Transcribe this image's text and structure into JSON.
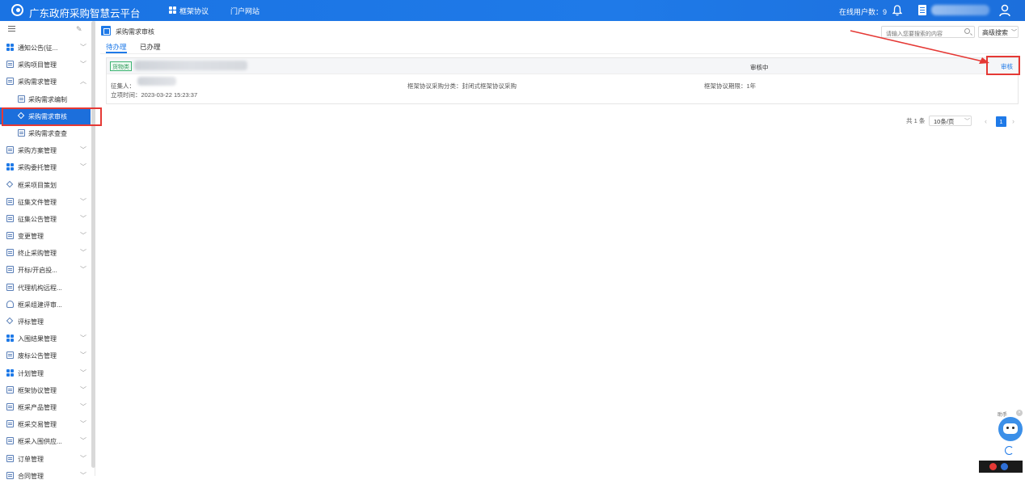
{
  "header": {
    "app_title": "广东政府采购智慧云平台",
    "nav": [
      "框架协议",
      "门户网站"
    ],
    "online_users": "在线用户数：9"
  },
  "sidebar": {
    "items": [
      {
        "label": "通知公告(征...",
        "icon": "grid-icon",
        "expandable": true
      },
      {
        "label": "采购项目管理",
        "icon": "doc-icon",
        "expandable": true
      },
      {
        "label": "采购需求管理",
        "icon": "doc-icon",
        "expandable": true,
        "expanded": true
      },
      {
        "label": "采购需求编制",
        "icon": "edit-icon",
        "sub": true
      },
      {
        "label": "采购需求审核",
        "icon": "diamond-icon",
        "sub": true,
        "active": true
      },
      {
        "label": "采购需求查查",
        "icon": "doc-icon",
        "sub": true
      },
      {
        "label": "采购方案管理",
        "icon": "doc-icon",
        "expandable": true
      },
      {
        "label": "采购委托管理",
        "icon": "grid-icon",
        "expandable": true
      },
      {
        "label": "框采项目策划",
        "icon": "diamond-icon",
        "expandable": false
      },
      {
        "label": "征集文件管理",
        "icon": "doc-icon",
        "expandable": true
      },
      {
        "label": "征集公告管理",
        "icon": "doc-icon",
        "expandable": true
      },
      {
        "label": "变更管理",
        "icon": "doc-icon",
        "expandable": true
      },
      {
        "label": "终止采购管理",
        "icon": "doc-icon",
        "expandable": true
      },
      {
        "label": "开标/开启投...",
        "icon": "doc-icon",
        "expandable": true
      },
      {
        "label": "代理机构远程...",
        "icon": "doc-icon",
        "expandable": false
      },
      {
        "label": "框采组建评审...",
        "icon": "person-icon",
        "expandable": false
      },
      {
        "label": "评标管理",
        "icon": "diamond-icon",
        "expandable": false
      },
      {
        "label": "入围结果管理",
        "icon": "grid-icon",
        "expandable": true
      },
      {
        "label": "废标公告管理",
        "icon": "doc-icon",
        "expandable": true
      },
      {
        "label": "计划管理",
        "icon": "grid-icon",
        "expandable": true
      },
      {
        "label": "框架协议管理",
        "icon": "doc-icon",
        "expandable": true
      },
      {
        "label": "框采产品管理",
        "icon": "doc-icon",
        "expandable": true
      },
      {
        "label": "框采交易管理",
        "icon": "doc-icon",
        "expandable": true
      },
      {
        "label": "框采入围供应...",
        "icon": "doc-icon",
        "expandable": true
      },
      {
        "label": "订单管理",
        "icon": "doc-icon",
        "expandable": true
      },
      {
        "label": "合同管理",
        "icon": "doc-icon",
        "expandable": true
      }
    ]
  },
  "main": {
    "page_title": "采购需求审核",
    "search_placeholder": "请输入您要搜索的内容",
    "advanced_search": "高级搜索",
    "tabs": [
      {
        "label": "待办理",
        "active": true
      },
      {
        "label": "已办理",
        "active": false
      }
    ],
    "records": [
      {
        "tag": "货物类",
        "status": "审核中",
        "action": "审核",
        "collector_label": "征集人：",
        "procurement_type": "框架协议采购分类：封闭式框架协议采购",
        "period": "框架协议期限：1年",
        "created": "立项时间：2023-03-22 15:23:37"
      }
    ],
    "pagination": {
      "total": "共 1 条",
      "page_size": "10条/页",
      "current_page": "1"
    }
  },
  "assistant": {
    "label": "助手"
  },
  "colors": {
    "primary": "#1f7ae8",
    "highlight": "#e53935",
    "tag_green": "#2e9a5b"
  }
}
